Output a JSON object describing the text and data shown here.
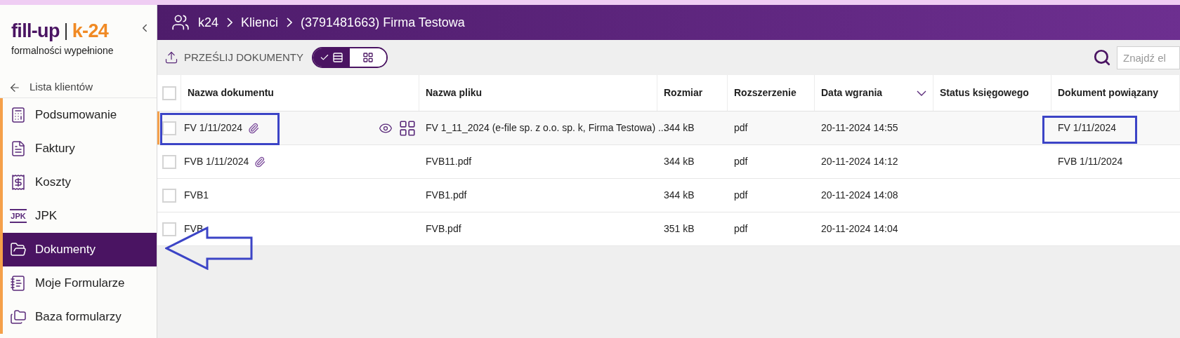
{
  "logo": {
    "brand_left": "fill-up",
    "brand_right": "k-24",
    "tagline": "formalności wypełnione"
  },
  "back_link": "Lista klientów",
  "sidebar": {
    "items": [
      {
        "label": "Podsumowanie",
        "selected": false,
        "arrow": false
      },
      {
        "label": "Faktury",
        "selected": false,
        "arrow": false
      },
      {
        "label": "Koszty",
        "selected": false,
        "arrow": false
      },
      {
        "label": "JPK",
        "icon_text": "JPK",
        "selected": false,
        "arrow": false
      },
      {
        "label": "Dokumenty",
        "selected": true,
        "arrow": true
      },
      {
        "label": "Moje Formularze",
        "selected": false,
        "arrow": false
      },
      {
        "label": "Baza formularzy",
        "selected": false,
        "arrow": false
      }
    ]
  },
  "breadcrumb": [
    "k24",
    "Klienci",
    "(3791481663) Firma Testowa"
  ],
  "toolbar": {
    "upload_label": "PRZEŚLIJ DOKUMENTY",
    "views": [
      {
        "selected": true
      },
      {
        "selected": false
      }
    ],
    "search": {
      "placeholder": "Znajdź el"
    }
  },
  "table": {
    "columns": [
      {
        "label": "Nazwa dokumentu",
        "sorted": false
      },
      {
        "label": "Nazwa pliku",
        "sorted": false
      },
      {
        "label": "Rozmiar",
        "sorted": false
      },
      {
        "label": "Rozszerzenie",
        "sorted": false
      },
      {
        "label": "Data wgrania",
        "sorted": true
      },
      {
        "label": "Status księgowego",
        "sorted": false
      },
      {
        "label": "Dokument powiązany",
        "sorted": false
      }
    ],
    "all_checked": false,
    "rows": [
      {
        "checked": false,
        "hovered": true,
        "annotated": true,
        "name": "FV 1/11/2024",
        "attachment": true,
        "file": "FV 1_11_2024 (e-file sp. z o.o. sp. k, Firma Testowa) ...",
        "size": "344 kB",
        "ext": "pdf",
        "date": "20-11-2024 14:55",
        "linked": "FV 1/11/2024"
      },
      {
        "checked": false,
        "hovered": false,
        "annotated": false,
        "name": "FVB 1/11/2024",
        "attachment": true,
        "file": "FVB11.pdf",
        "size": "344 kB",
        "ext": "pdf",
        "date": "20-11-2024 14:12",
        "linked": "FVB 1/11/2024"
      },
      {
        "checked": false,
        "hovered": false,
        "annotated": false,
        "name": "FVB1",
        "attachment": false,
        "file": "FVB1.pdf",
        "size": "344 kB",
        "ext": "pdf",
        "date": "20-11-2024 14:08"
      },
      {
        "checked": false,
        "hovered": false,
        "annotated": false,
        "name": "FVB",
        "attachment": false,
        "file": "FVB.pdf",
        "size": "351 kB",
        "ext": "pdf",
        "date": "20-11-2024 14:04"
      }
    ]
  }
}
